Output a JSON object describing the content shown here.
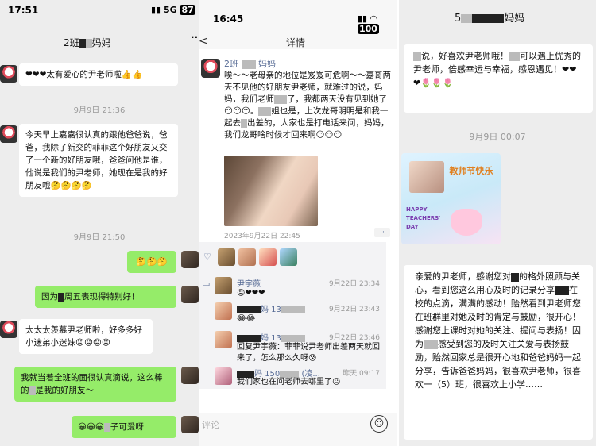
{
  "panel1": {
    "status_time": "17:51",
    "status_net": "5G",
    "status_battery": "87",
    "title_prefix": "2班",
    "title_suffix": "妈妈",
    "more_label": "···",
    "messages": [
      {
        "text": "❤❤❤太有爱心的尹老师啦👍👍"
      },
      {
        "time": "9月9日 21:36"
      },
      {
        "text": "今天早上嘉嘉很认真的跟他爸爸说，爸爸，我除了新交的菲菲这个好朋友又交了一个新的好朋友哦，爸爸问他是谁，他说是我们的尹老师，她现在是我的好朋友哦🤔🤔🤔🤔"
      },
      {
        "time": "9月9日 21:50"
      },
      {
        "text": "🤔🤔🤔"
      },
      {
        "text_prefix": "因为",
        "text_suffix": "周五表现得特别好！"
      },
      {
        "text": "太太太羡慕尹老师啦，好多多好小迷弟小迷妹😛😛😛😛"
      },
      {
        "text_prefix": "我就当着全班的面很认真滴说，这么棒的",
        "text_suffix": "是我的好朋友～"
      },
      {
        "text_prefix": "😀😀😀",
        "text_suffix": "子可爱呀"
      }
    ]
  },
  "panel2": {
    "status_time": "16:45",
    "status_battery": "100",
    "title": "详情",
    "back_label": "<",
    "post_author_prefix": "2班",
    "post_author_suffix": "妈妈",
    "post_text_1": "唉～～老母亲的地位是岌岌可危啊～～嘉哥两天不见他的好朋友尹老师，就难过的说，妈妈，我们老师",
    "post_text_2": "了，我都两天没有见到她了😶😶😶。",
    "post_text_3": "姐也是，上次龙哥明明是和我一起去",
    "post_text_4": "出差的，人家也是打电话来问，妈妈，我们龙哥啥时候才回来啊😶😶😶",
    "post_date": "2023年9月22日 22:45",
    "more_label": "··",
    "comments": [
      {
        "name": "尹宇薇",
        "time": "9月22日 23:34",
        "text": "😝❤❤❤"
      },
      {
        "name_suffix": "妈 13",
        "time": "9月22日 23:43",
        "text": "😂😂"
      },
      {
        "name_suffix": "妈 13",
        "time": "9月22日 23:46",
        "text": "回复尹宇薇：菲菲说尹老师出差两天就回来了，怎么那么久呀😰"
      },
      {
        "name_suffix": "妈 150",
        "name_extra": "(凌...",
        "time": "昨天 09:17",
        "text": "我们家也在问老师去哪里了😐"
      }
    ],
    "comment_placeholder": "评论"
  },
  "panel3": {
    "title_prefix": "5",
    "title_suffix": "妈妈",
    "card1_text": "说，好喜欢尹老师哦！",
    "card1_text2": "可以遇上优秀的尹老师，倍感幸运与幸福，感恩遇见！❤❤❤🌷🌷🌷",
    "time": "9月9日 00:07",
    "tcard_title": "教师节快乐",
    "tcard_line1": "HAPPY",
    "tcard_line2": "TEACHERS'",
    "tcard_line3": "DAY",
    "card2_text": "亲爱的尹老师，感谢您对",
    "card2_text2": "的格外照顾与关心，看到您这么用心及时的记录分享",
    "card2_text3": "在校的点滴，满满的感动！贻然看到尹老师您在班群里对她及时的肯定与鼓励，很开心！感谢您上课时对她的关注、提问与表扬！因为",
    "card2_text4": "感受到您的及时关注关爱与表扬鼓励，贻然回家总是很开心地和爸爸妈妈一起分享，告诉爸爸妈妈，很喜欢尹老师，很喜欢一（5）班，很喜欢上小学……"
  }
}
